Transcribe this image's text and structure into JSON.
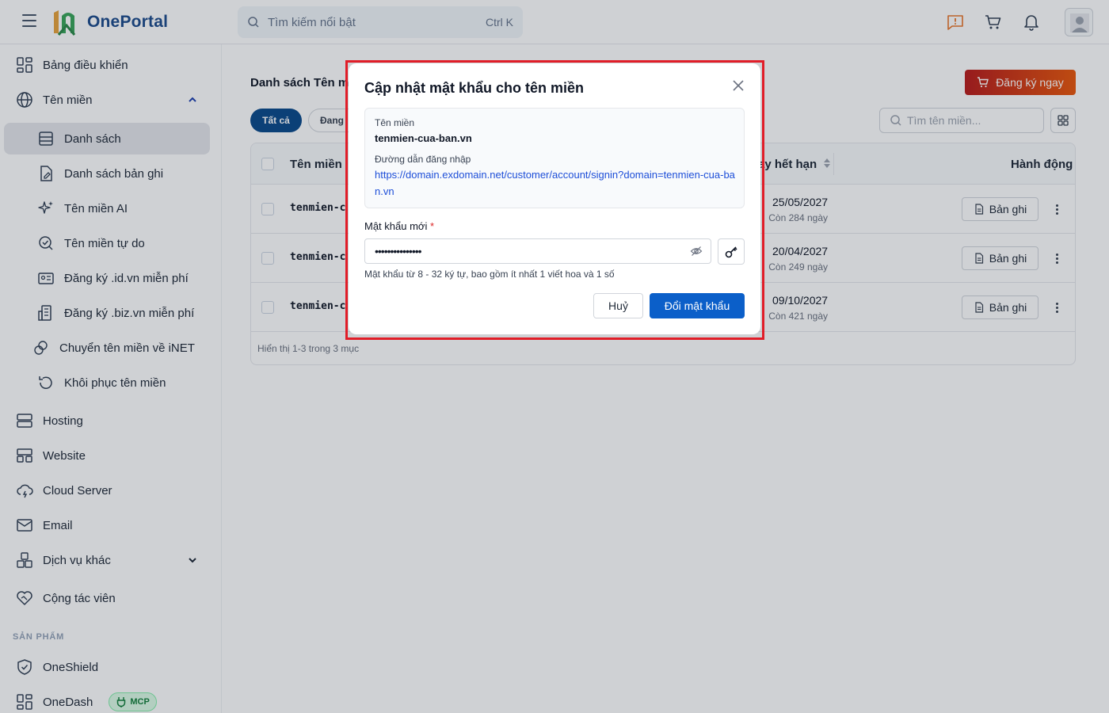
{
  "app": {
    "name": "OnePortal"
  },
  "search": {
    "placeholder": "Tìm kiếm nổi bật",
    "shortcut": "Ctrl K"
  },
  "sidebar": {
    "items": [
      {
        "label": "Bảng điều khiển"
      },
      {
        "label": "Tên miền"
      },
      {
        "label": "Danh sách"
      },
      {
        "label": "Danh sách bản ghi"
      },
      {
        "label": "Tên miền AI"
      },
      {
        "label": "Tên miền tự do"
      },
      {
        "label": "Đăng ký .id.vn miễn phí"
      },
      {
        "label": "Đăng ký .biz.vn miễn phí"
      },
      {
        "label": "Chuyển tên miền về iNET"
      },
      {
        "label": "Khôi phục tên miền"
      },
      {
        "label": "Hosting"
      },
      {
        "label": "Website"
      },
      {
        "label": "Cloud Server"
      },
      {
        "label": "Email"
      },
      {
        "label": "Dịch vụ khác"
      },
      {
        "label": "Cộng tác viên"
      }
    ],
    "section_products": "SẢN PHẨM",
    "products": [
      {
        "label": "OneShield"
      },
      {
        "label": "OneDash",
        "badge": "MCP"
      }
    ]
  },
  "main": {
    "title": "Danh sách Tên mi",
    "register_button": "Đăng ký ngay",
    "filters": [
      {
        "label": "Tất cả"
      },
      {
        "label": "Đang"
      }
    ],
    "domain_search_placeholder": "Tìm tên miền...",
    "table": {
      "headers": {
        "name": "Tên miền",
        "expiry": "ay hết hạn",
        "actions": "Hành động"
      },
      "rows": [
        {
          "name": "tenmien-c",
          "expiry_date": "25/05/2027",
          "remaining": "Còn 284 ngày",
          "action": "Bản ghi"
        },
        {
          "name": "tenmien-c",
          "expiry_date": "20/04/2027",
          "remaining": "Còn 249 ngày",
          "action": "Bản ghi"
        },
        {
          "name": "tenmien-c",
          "expiry_date": "09/10/2027",
          "remaining": "Còn 421 ngày",
          "action": "Bản ghi"
        }
      ],
      "footer": "Hiển thị 1-3 trong 3 mục"
    }
  },
  "modal": {
    "title": "Cập nhật mật khẩu cho tên miền",
    "domain_label": "Tên miền",
    "domain_value": "tenmien-cua-ban.vn",
    "login_url_label": "Đường dẫn đăng nhập",
    "login_url": "https://domain.exdomain.net/customer/account/signin?domain=tenmien-cua-ban.vn",
    "password_label": "Mật khẩu mới",
    "required_mark": "*",
    "password_value": "•••••••••••••••",
    "hint": "Mật khẩu từ 8 - 32 ký tự, bao gồm ít nhất 1 viết hoa và 1 số",
    "cancel_button": "Huỷ",
    "submit_button": "Đổi mật khẩu"
  },
  "colors": {
    "primary": "#0b5fc9",
    "brand_navy": "#0b4a8b",
    "register_gradient_start": "#b91c1c",
    "register_gradient_end": "#ea580c",
    "highlight_frame": "#e11d28"
  }
}
